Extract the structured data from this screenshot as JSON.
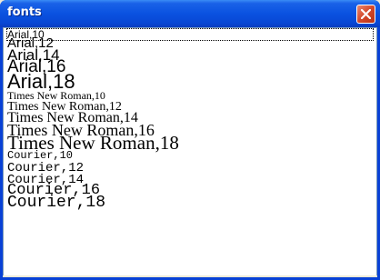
{
  "window": {
    "title": "fonts"
  },
  "list": {
    "items": [
      {
        "label": "Arial,10"
      },
      {
        "label": "Arial,12"
      },
      {
        "label": "Arial,14"
      },
      {
        "label": "Arial,16"
      },
      {
        "label": "Arial,18"
      },
      {
        "label": "Times New Roman,10"
      },
      {
        "label": "Times New Roman,12"
      },
      {
        "label": "Times New Roman,14"
      },
      {
        "label": "Times New Roman,16"
      },
      {
        "label": "Times New Roman,18"
      },
      {
        "label": "Courier,10"
      },
      {
        "label": "Courier,12"
      },
      {
        "label": "Courier,14"
      },
      {
        "label": "Courier,16"
      },
      {
        "label": "Courier,18"
      }
    ]
  }
}
